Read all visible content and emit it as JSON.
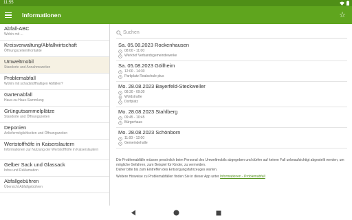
{
  "statusbar": {
    "time": "11:55"
  },
  "appbar": {
    "title": "Informationen",
    "menu_icon": "hamburger-menu-icon",
    "star_icon": "star-outline-icon"
  },
  "sidebar": {
    "items": [
      {
        "label": "Abfall-ABC",
        "sub": "Wohin mit ..."
      },
      {
        "label": "Kreisverwaltung/Abfallwirtschaft",
        "sub": "Öffnungszeiten/Kontakte"
      },
      {
        "label": "Umweltmobil",
        "sub": "Standorte und Annahmezeiten"
      },
      {
        "label": "Problemabfall",
        "sub": "Wohin mit schadstoffhaltigen Abfällen?"
      },
      {
        "label": "Gartenabfall",
        "sub": "Haus-zu-Haus-Sammlung"
      },
      {
        "label": "Grüngutsammelplätze",
        "sub": "Standorte und Öffnungszeiten"
      },
      {
        "label": "Deponien",
        "sub": "Anliefermöglichkeiten und Öffnungszeiten"
      },
      {
        "label": "Wertstoffhöfe in Kaiserslautern",
        "sub": "Informationen zur Nutzung der Wertstoffhöfe in Kaiserslautern"
      },
      {
        "label": "Gelber Sack und Glassack",
        "sub": "Infos und Reklamation"
      },
      {
        "label": "Abfallgebühren",
        "sub": "Übersicht Abfallgebühren"
      }
    ]
  },
  "search": {
    "placeholder": "Suchen"
  },
  "events": [
    {
      "title": "Sa. 05.08.2023 Rockenhausen",
      "time": "08:00 - 11:00",
      "place": "Werkhof Verbandsgemeindewerke",
      "place_icon": "clock-icon"
    },
    {
      "title": "Sa. 05.08.2023 Göllheim",
      "time": "12:00 - 14:30",
      "place": "Parkplatz Realschule plus",
      "place_icon": "clock-icon"
    },
    {
      "title": "Mo. 28.08.2023 Bayerfeld-Steckweiler",
      "time": "08:30 - 09:30",
      "place": "Woldstraße",
      "place2": "Dorfplatz",
      "place_icon": "location-pin-icon"
    },
    {
      "title": "Mo. 28.08.2023 Stahlberg",
      "time": "09:45 - 10:45",
      "place": "Bürgerhaus",
      "place_icon": "clock-icon"
    },
    {
      "title": "Mo. 28.08.2023 Schönborn",
      "time": "11:00 - 12:00",
      "place": "Gemeindehalle",
      "place_icon": "clock-icon"
    }
  ],
  "info": {
    "p1": "Die Problemabfälle müssen persönlich beim Personal des Umweltmobils abgegeben und dürfen auf keinen Fall unbeaufsichtigt abgestellt werden, um mögliche Gefahren, zum Beispiel für Kinder, zu vermeiden.",
    "p1b": "Daher bitte bis zum Eintreffen des Entsorgungsfahrzeuges warten.",
    "p2": "Weitere Hinweise zu Problemabfällen finden Sie in dieser App unter",
    "link": "Informationen - Problemabfall"
  },
  "navbar": {
    "back_icon": "back-triangle-icon",
    "home_icon": "home-circle-icon",
    "recents_icon": "recents-square-icon"
  }
}
